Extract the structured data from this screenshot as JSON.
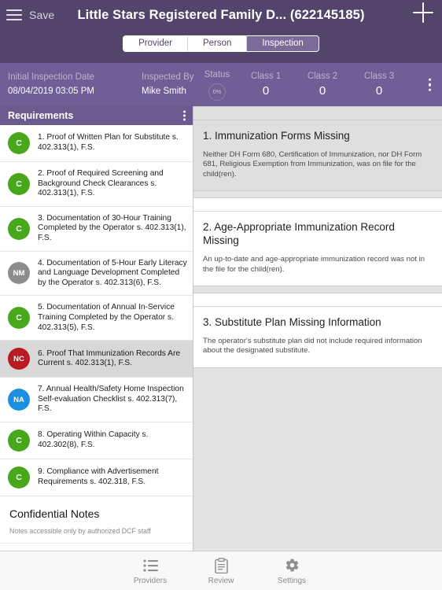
{
  "colors": {
    "nav_bg": "#54436b",
    "info_bg": "#6f5f96",
    "req_header_bg": "#6a5a8e",
    "badge_c": "#47a81b",
    "badge_nm": "#8d8d8d",
    "badge_nc": "#b81c22",
    "badge_na": "#1b8fe0"
  },
  "nav": {
    "menu_icon": "hamburger-icon",
    "save_label": "Save",
    "title": "Little Stars Registered Family D...  (622145185)",
    "add_icon": "plus-icon"
  },
  "segmented": {
    "options": [
      {
        "label": "Provider",
        "active": false
      },
      {
        "label": "Person",
        "active": false
      },
      {
        "label": "Inspection",
        "active": true
      }
    ]
  },
  "info": {
    "date_label": "Initial Inspection Date",
    "date_value": "08/04/2019 03:05 PM",
    "inspector_label": "Inspected By",
    "inspector_value": "Mike Smith",
    "status_label": "Status",
    "status_value": "0%",
    "class1_label": "Class 1",
    "class1_value": "0",
    "class2_label": "Class 2",
    "class2_value": "0",
    "class3_label": "Class 3",
    "class3_value": "0",
    "overflow_icon": "kebab-menu-icon"
  },
  "requirements": {
    "header": "Requirements",
    "overflow_icon": "kebab-menu-icon",
    "items": [
      {
        "status": "C",
        "color": "#47a81b",
        "text": "1. Proof of Written Plan for Substitute s. 402.313(1), F.S.",
        "selected": false
      },
      {
        "status": "C",
        "color": "#47a81b",
        "text": "2. Proof of Required Screening and Background Check Clearances s. 402.313(1), F.S.",
        "selected": false
      },
      {
        "status": "C",
        "color": "#47a81b",
        "text": "3. Documentation of 30-Hour Training Completed by the Operator s. 402.313(1), F.S.",
        "selected": false
      },
      {
        "status": "NM",
        "color": "#8d8d8d",
        "text": "4. Documentation of 5-Hour Early Literacy and Language Development Completed by the Operator s. 402.313(6), F.S.",
        "selected": false
      },
      {
        "status": "C",
        "color": "#47a81b",
        "text": "5. Documentation of Annual In-Service Training Completed by the Operator s. 402.313(5), F.S.",
        "selected": false
      },
      {
        "status": "NC",
        "color": "#b81c22",
        "text": "6. Proof That Immunization Records Are Current s. 402.313(1), F.S.",
        "selected": true
      },
      {
        "status": "NA",
        "color": "#1b8fe0",
        "text": "7. Annual Health/Safety Home Inspection Self-evaluation Checklist s. 402.313(7), F.S.",
        "selected": false
      },
      {
        "status": "C",
        "color": "#47a81b",
        "text": "8. Operating Within Capacity s. 402.302(8), F.S.",
        "selected": false
      },
      {
        "status": "C",
        "color": "#47a81b",
        "text": "9. Compliance with Advertisement Requirements s. 402.318, F.S.",
        "selected": false
      }
    ]
  },
  "notes": {
    "title": "Confidential Notes",
    "subtitle": "Notes accessible only by authorized DCF staff"
  },
  "violations": [
    {
      "title": "1. Immunization Forms Missing",
      "description": "Neither DH Form 680, Certification of Immunization, nor DH Form 681, Religious Exemption from Immunization, was on file for the child(ren).",
      "muted": true
    },
    {
      "title": "2. Age-Appropriate Immunization Record Missing",
      "description": "An up-to-date and age-appropriate immunization record was not in the file for the child(ren).",
      "muted": false
    },
    {
      "title": "3. Substitute Plan Missing Information",
      "description": "The operator's substitute plan did not include required information about the designated substitute.",
      "muted": false
    }
  ],
  "tabbar": {
    "tabs": [
      {
        "label": "Providers",
        "icon": "list-icon"
      },
      {
        "label": "Review",
        "icon": "clipboard-icon"
      },
      {
        "label": "Settings",
        "icon": "gear-icon"
      }
    ]
  }
}
